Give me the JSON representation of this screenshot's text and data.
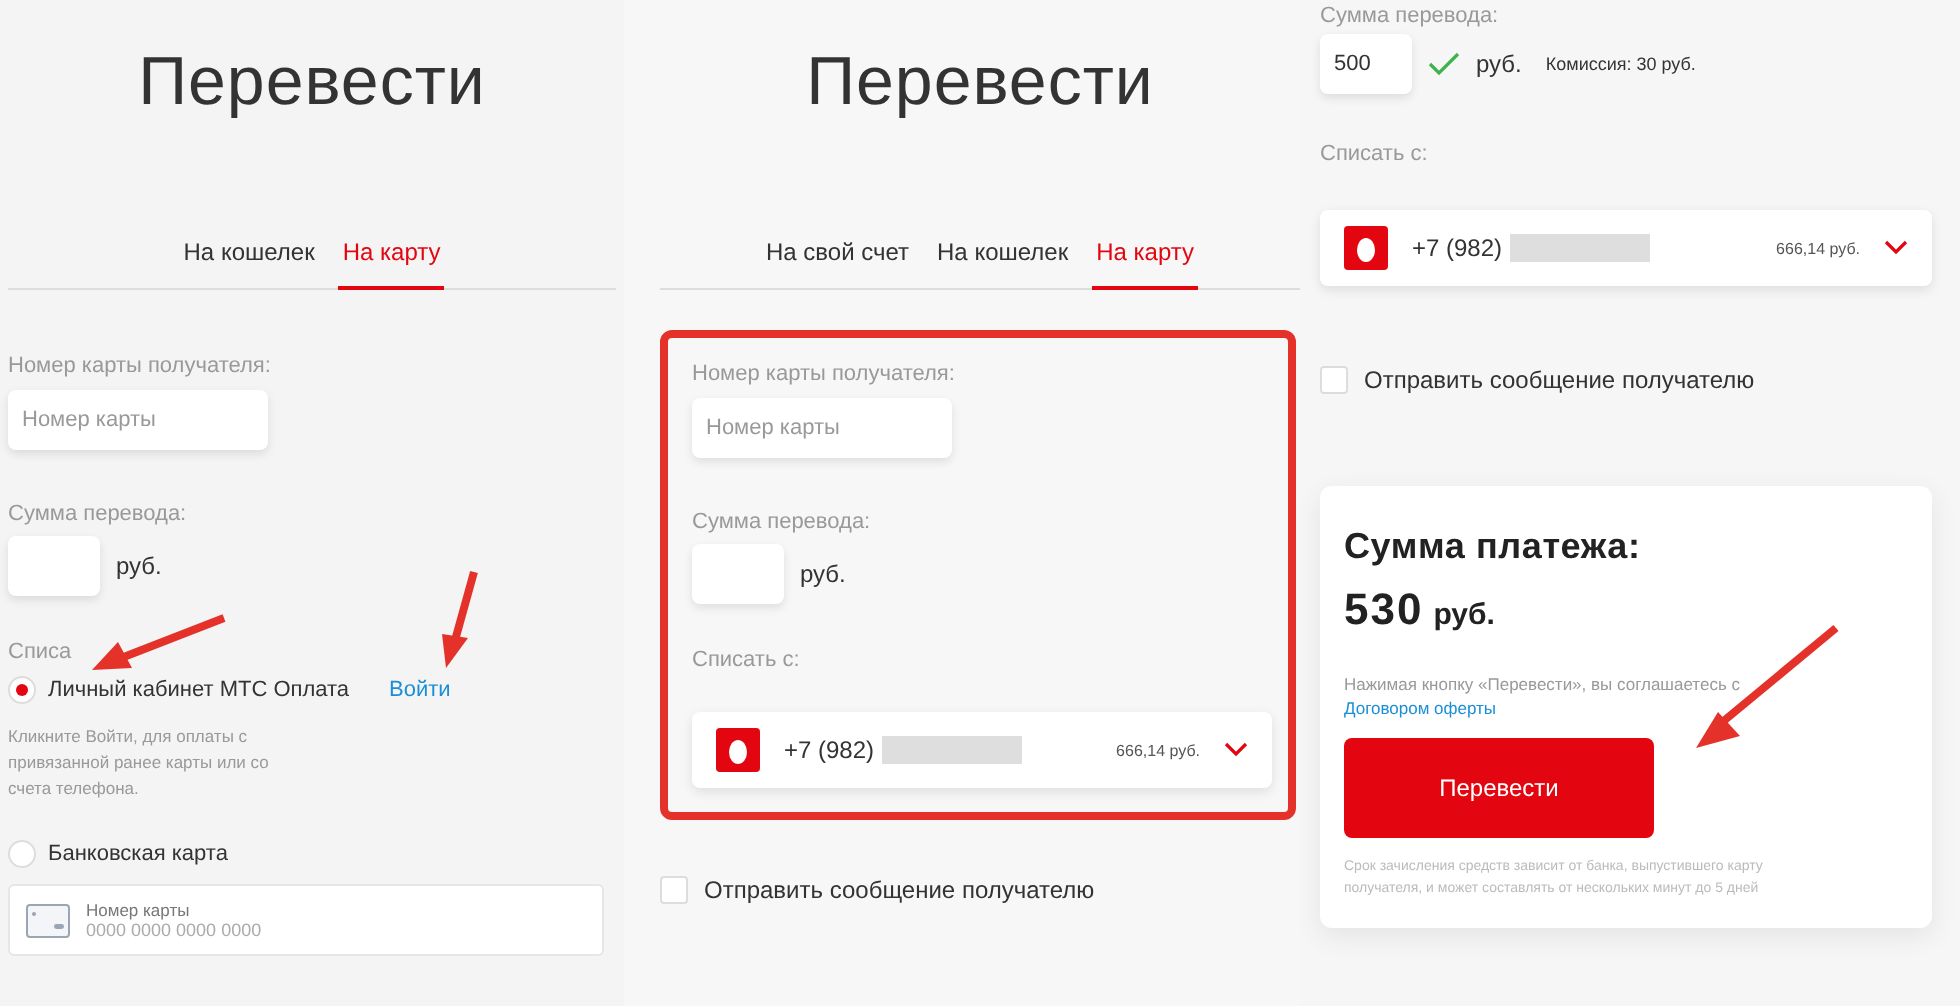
{
  "left_panel": {
    "title": "Перевести",
    "tabs": [
      {
        "label": "На кошелек",
        "selected": false
      },
      {
        "label": "На карту",
        "selected": true
      }
    ],
    "card_number": {
      "label": "Номер карты получателя:",
      "placeholder": "Номер карты"
    },
    "amount": {
      "label": "Сумма перевода:",
      "currency": "руб."
    },
    "debit_label": "Списа",
    "payment_options": [
      {
        "label": "Личный кабинет МТС Оплата",
        "selected": true,
        "link": "Войти",
        "hint": "Кликните Войти, для оплаты с привязанной ранее карты или со счета телефона."
      },
      {
        "label": "Банковская карта",
        "selected": false
      }
    ],
    "bank_card": {
      "label": "Номер карты",
      "placeholder": "0000 0000 0000 0000"
    }
  },
  "middle_panel": {
    "title": "Перевести",
    "tabs": [
      {
        "label": "На свой счет",
        "selected": false
      },
      {
        "label": "На кошелек",
        "selected": false
      },
      {
        "label": "На карту",
        "selected": true
      }
    ],
    "card_number": {
      "label": "Номер карты получателя:",
      "placeholder": "Номер карты"
    },
    "amount": {
      "label": "Сумма перевода:",
      "currency": "руб."
    },
    "debit_label": "Списать с:",
    "account": {
      "phone": "+7 (982)",
      "balance": "666,14 руб."
    },
    "send_message": {
      "label": "Отправить сообщение получателю",
      "checked": false
    }
  },
  "right_panel": {
    "amount": {
      "label": "Сумма перевода:",
      "value": "500",
      "valid": true,
      "currency": "руб.",
      "commission": "Комиссия: 30 руб."
    },
    "debit_label": "Списать с:",
    "account": {
      "phone": "+7 (982)",
      "balance": "666,14 руб."
    },
    "send_message": {
      "label": "Отправить сообщение получателю",
      "checked": false
    },
    "summary": {
      "title": "Сумма платежа:",
      "amount": "530",
      "currency": "руб.",
      "note": "Нажимая кнопку «Перевести», вы соглашаетесь с",
      "link": "Договором оферты",
      "button": "Перевести",
      "footnote": "Срок зачисления средств зависит от банка, выпустившего карту получателя, и может составлять от нескольких минут до 5 дней"
    }
  }
}
